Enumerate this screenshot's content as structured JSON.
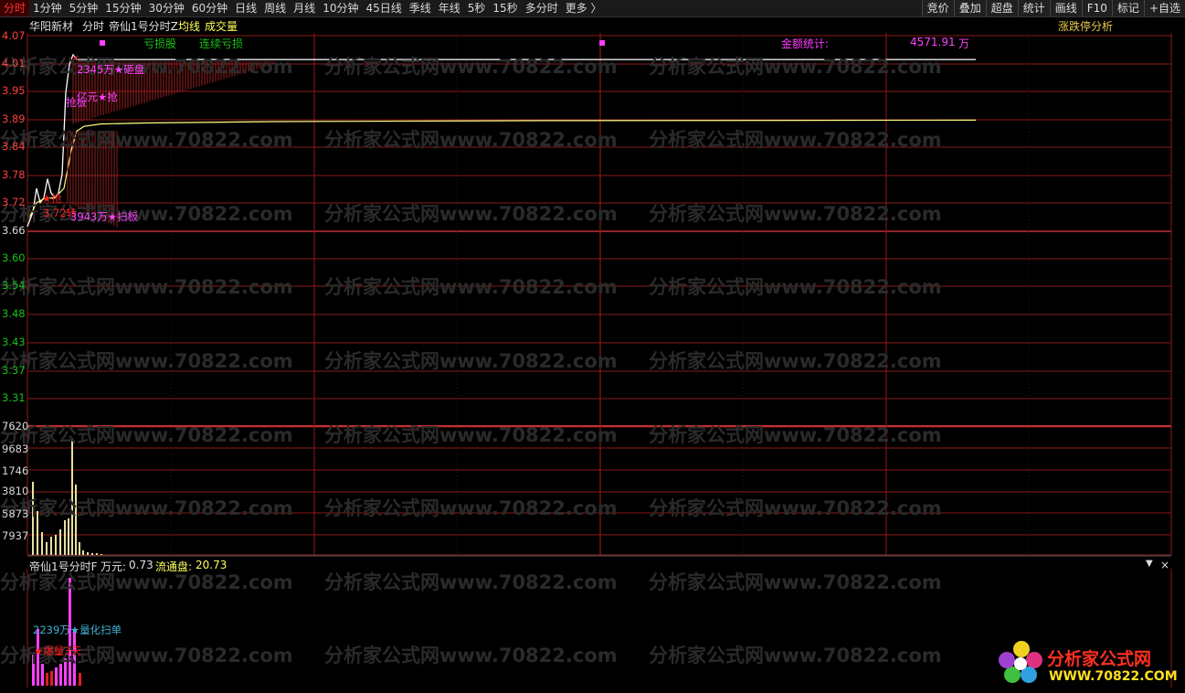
{
  "toolbar": {
    "periods": [
      "分时",
      "1分钟",
      "5分钟",
      "15分钟",
      "30分钟",
      "60分钟",
      "日线",
      "周线",
      "月线",
      "10分钟",
      "45日线",
      "季线",
      "年线",
      "5秒",
      "15秒",
      "多分时",
      "更多 〉"
    ],
    "right_buttons": [
      "竞价",
      "叠加",
      "超盘",
      "统计",
      "画线",
      "F10",
      "标记",
      "+自选"
    ]
  },
  "header": {
    "stock_name": "华阳新材",
    "mode": "分时",
    "indicator": "帝仙1号分时Z",
    "avg_label": "均线",
    "vol_label": "成交量",
    "right_link": "涨跌停分析"
  },
  "legend": {
    "loss_stock": "亏损股",
    "consecutive_loss": "连续亏损",
    "amount_stat_label": "金额统计:",
    "amount_stat_value": "4571.91",
    "amount_stat_unit": "万"
  },
  "price_axis": {
    "red_ticks": [
      "4.07",
      "4.01",
      "3.95",
      "3.89",
      "3.84",
      "3.78",
      "3.72"
    ],
    "pivot": "3.66",
    "green_ticks": [
      "3.60",
      "3.54",
      "3.48",
      "3.43",
      "3.37",
      "3.31"
    ]
  },
  "volume_axis": [
    "7620",
    "9683",
    "1746",
    "3810",
    "5873",
    "7937"
  ],
  "annotations": {
    "a1": "2345万★砸盘",
    "a2": "亿元★抢",
    "a2b": "抢板",
    "a3": "★抢",
    "a4": "3.72转",
    "a5": "3943万★扫板"
  },
  "sub_panel": {
    "indicator": "帝仙1号分时F",
    "wan_label": "万元:",
    "wan_value": "0.73",
    "float_label": "流通盘:",
    "float_value": "20.73",
    "annot1": "2239万★量化扫单",
    "annot2": "★爆量3天"
  },
  "watermark": "分析家公式网www.70822.com",
  "logo": {
    "text": "分析家公式网",
    "url": "WWW.70822.COM"
  },
  "colors": {
    "price_line": "#ffffff",
    "avg_line": "#ffff80",
    "grid": "#8b1a1a",
    "up_red": "#ff4040",
    "down_green": "#18c018",
    "magenta": "#ff40ff",
    "volume_bar": "#e8e0a0"
  }
}
